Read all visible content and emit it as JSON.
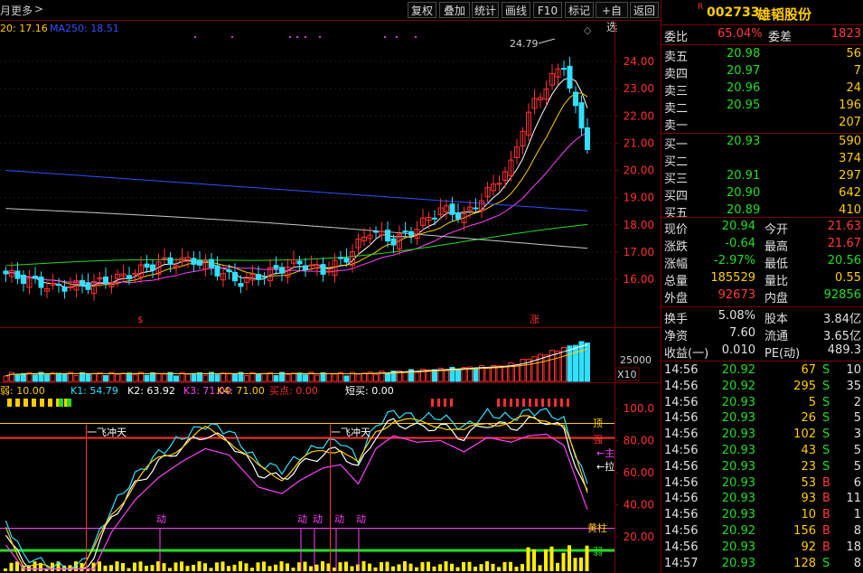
{
  "toolbar": {
    "left_labels": [
      "月",
      "更多",
      ">"
    ],
    "buttons": [
      "复权",
      "叠加",
      "统计",
      "画线",
      "F10",
      "标记",
      "+自选",
      "返回"
    ]
  },
  "price_chart": {
    "ma_legend": [
      {
        "label": "20: 17.16",
        "color": "#ffcc00"
      },
      {
        "label": "MA250: 18.51",
        "color": "#3050ff"
      }
    ],
    "y_ticks": [
      "24.00",
      "23.00",
      "22.00",
      "21.00",
      "20.00",
      "19.00",
      "18.00",
      "17.00",
      "16.00"
    ],
    "high_annotation": "24.79",
    "markers": [
      "$",
      "涨"
    ]
  },
  "volume_chart": {
    "y_tick": "25000",
    "unit_label": "X10"
  },
  "indicator": {
    "legend": [
      {
        "label": "弱: 10.00",
        "color": "#ffcc00"
      },
      {
        "label": "K1: 54.79",
        "color": "#30e0ff"
      },
      {
        "label": "K2: 63.92",
        "color": "#ffffff"
      },
      {
        "label": "K3: 71.00",
        "color": "#ff40ff"
      },
      {
        "label": "K4: 71.00",
        "color": "#ffcc00"
      },
      {
        "label": "买点: 0.00",
        "color": "#ff3030"
      },
      {
        "label": "短买: 0.00",
        "color": "#ffffff"
      }
    ],
    "y_ticks": [
      "100.0",
      "80.00",
      "60.00",
      "40.00",
      "20.00"
    ],
    "right_labels": [
      "顶",
      "强",
      "←主",
      "←拉",
      "黄柱",
      "弱"
    ],
    "annotations": [
      "一飞冲天",
      "一飞冲天",
      "动",
      "动",
      "动",
      "动",
      "动"
    ]
  },
  "stock": {
    "badge": "R",
    "code": "002733",
    "name": "雄韬股份",
    "weibi_label": "委比",
    "weibi_value": "65.04%",
    "weicha_label": "委差",
    "weicha_value": "1823",
    "asks": [
      {
        "label": "卖五",
        "price": "20.98",
        "vol": "56"
      },
      {
        "label": "卖四",
        "price": "20.97",
        "vol": "7"
      },
      {
        "label": "卖三",
        "price": "20.96",
        "vol": "24"
      },
      {
        "label": "卖二",
        "price": "20.95",
        "vol": "196"
      },
      {
        "label": "卖一",
        "price": "",
        "vol": "207"
      }
    ],
    "bids": [
      {
        "label": "买一",
        "price": "20.93",
        "vol": "590"
      },
      {
        "label": "买二",
        "price": "",
        "vol": "374"
      },
      {
        "label": "买三",
        "price": "20.91",
        "vol": "297"
      },
      {
        "label": "买四",
        "price": "20.90",
        "vol": "642"
      },
      {
        "label": "买五",
        "price": "20.89",
        "vol": "410"
      }
    ],
    "quote": [
      {
        "l1": "现价",
        "v1": "20.94",
        "c1": "g",
        "l2": "今开",
        "v2": "21.63",
        "c2": "r"
      },
      {
        "l1": "涨跌",
        "v1": "-0.64",
        "c1": "g",
        "l2": "最高",
        "v2": "21.67",
        "c2": "r"
      },
      {
        "l1": "涨幅",
        "v1": "-2.97%",
        "c1": "g",
        "l2": "最低",
        "v2": "20.56",
        "c2": "g"
      },
      {
        "l1": "总量",
        "v1": "185529",
        "c1": "y",
        "l2": "量比",
        "v2": "0.55",
        "c2": "y"
      },
      {
        "l1": "外盘",
        "v1": "92673",
        "c1": "r",
        "l2": "内盘",
        "v2": "92856",
        "c2": "g"
      }
    ],
    "stats": [
      {
        "l1": "换手",
        "v1": "5.08%",
        "l2": "股本",
        "v2": "3.84亿"
      },
      {
        "l1": "净资",
        "v1": "7.60",
        "l2": "流通",
        "v2": "3.65亿"
      },
      {
        "l1": "收益(一)",
        "v1": "0.010",
        "l2": "PE(动)",
        "v2": "489.3"
      }
    ],
    "ticks": [
      {
        "time": "14:56",
        "price": "20.92",
        "vol": "67",
        "side": "S",
        "n": "10"
      },
      {
        "time": "14:56",
        "price": "20.92",
        "vol": "295",
        "side": "S",
        "n": "35"
      },
      {
        "time": "14:56",
        "price": "20.93",
        "vol": "5",
        "side": "S",
        "n": "2"
      },
      {
        "time": "14:56",
        "price": "20.93",
        "vol": "26",
        "side": "S",
        "n": "5"
      },
      {
        "time": "14:56",
        "price": "20.93",
        "vol": "102",
        "side": "S",
        "n": "3"
      },
      {
        "time": "14:56",
        "price": "20.93",
        "vol": "43",
        "side": "S",
        "n": "5"
      },
      {
        "time": "14:56",
        "price": "20.93",
        "vol": "23",
        "side": "S",
        "n": "5"
      },
      {
        "time": "14:56",
        "price": "20.93",
        "vol": "53",
        "side": "B",
        "n": "6"
      },
      {
        "time": "14:56",
        "price": "20.93",
        "vol": "93",
        "side": "B",
        "n": "11"
      },
      {
        "time": "14:56",
        "price": "20.93",
        "vol": "10",
        "side": "B",
        "n": "1"
      },
      {
        "time": "14:56",
        "price": "20.92",
        "vol": "156",
        "side": "B",
        "n": "8"
      },
      {
        "time": "14:56",
        "price": "20.93",
        "vol": "92",
        "side": "B",
        "n": "18"
      },
      {
        "time": "14:57",
        "price": "20.93",
        "vol": "128",
        "side": "S",
        "n": "8"
      }
    ]
  },
  "colors": {
    "up": "#ff3030",
    "down": "#30e0ff",
    "ma5": "#ffffff",
    "ma10": "#ffcc00",
    "ma20": "#ff40ff",
    "ma60": "#22dd22",
    "ma120": "#c8c8c8",
    "ma250": "#3050ff",
    "border": "#7a0000"
  }
}
